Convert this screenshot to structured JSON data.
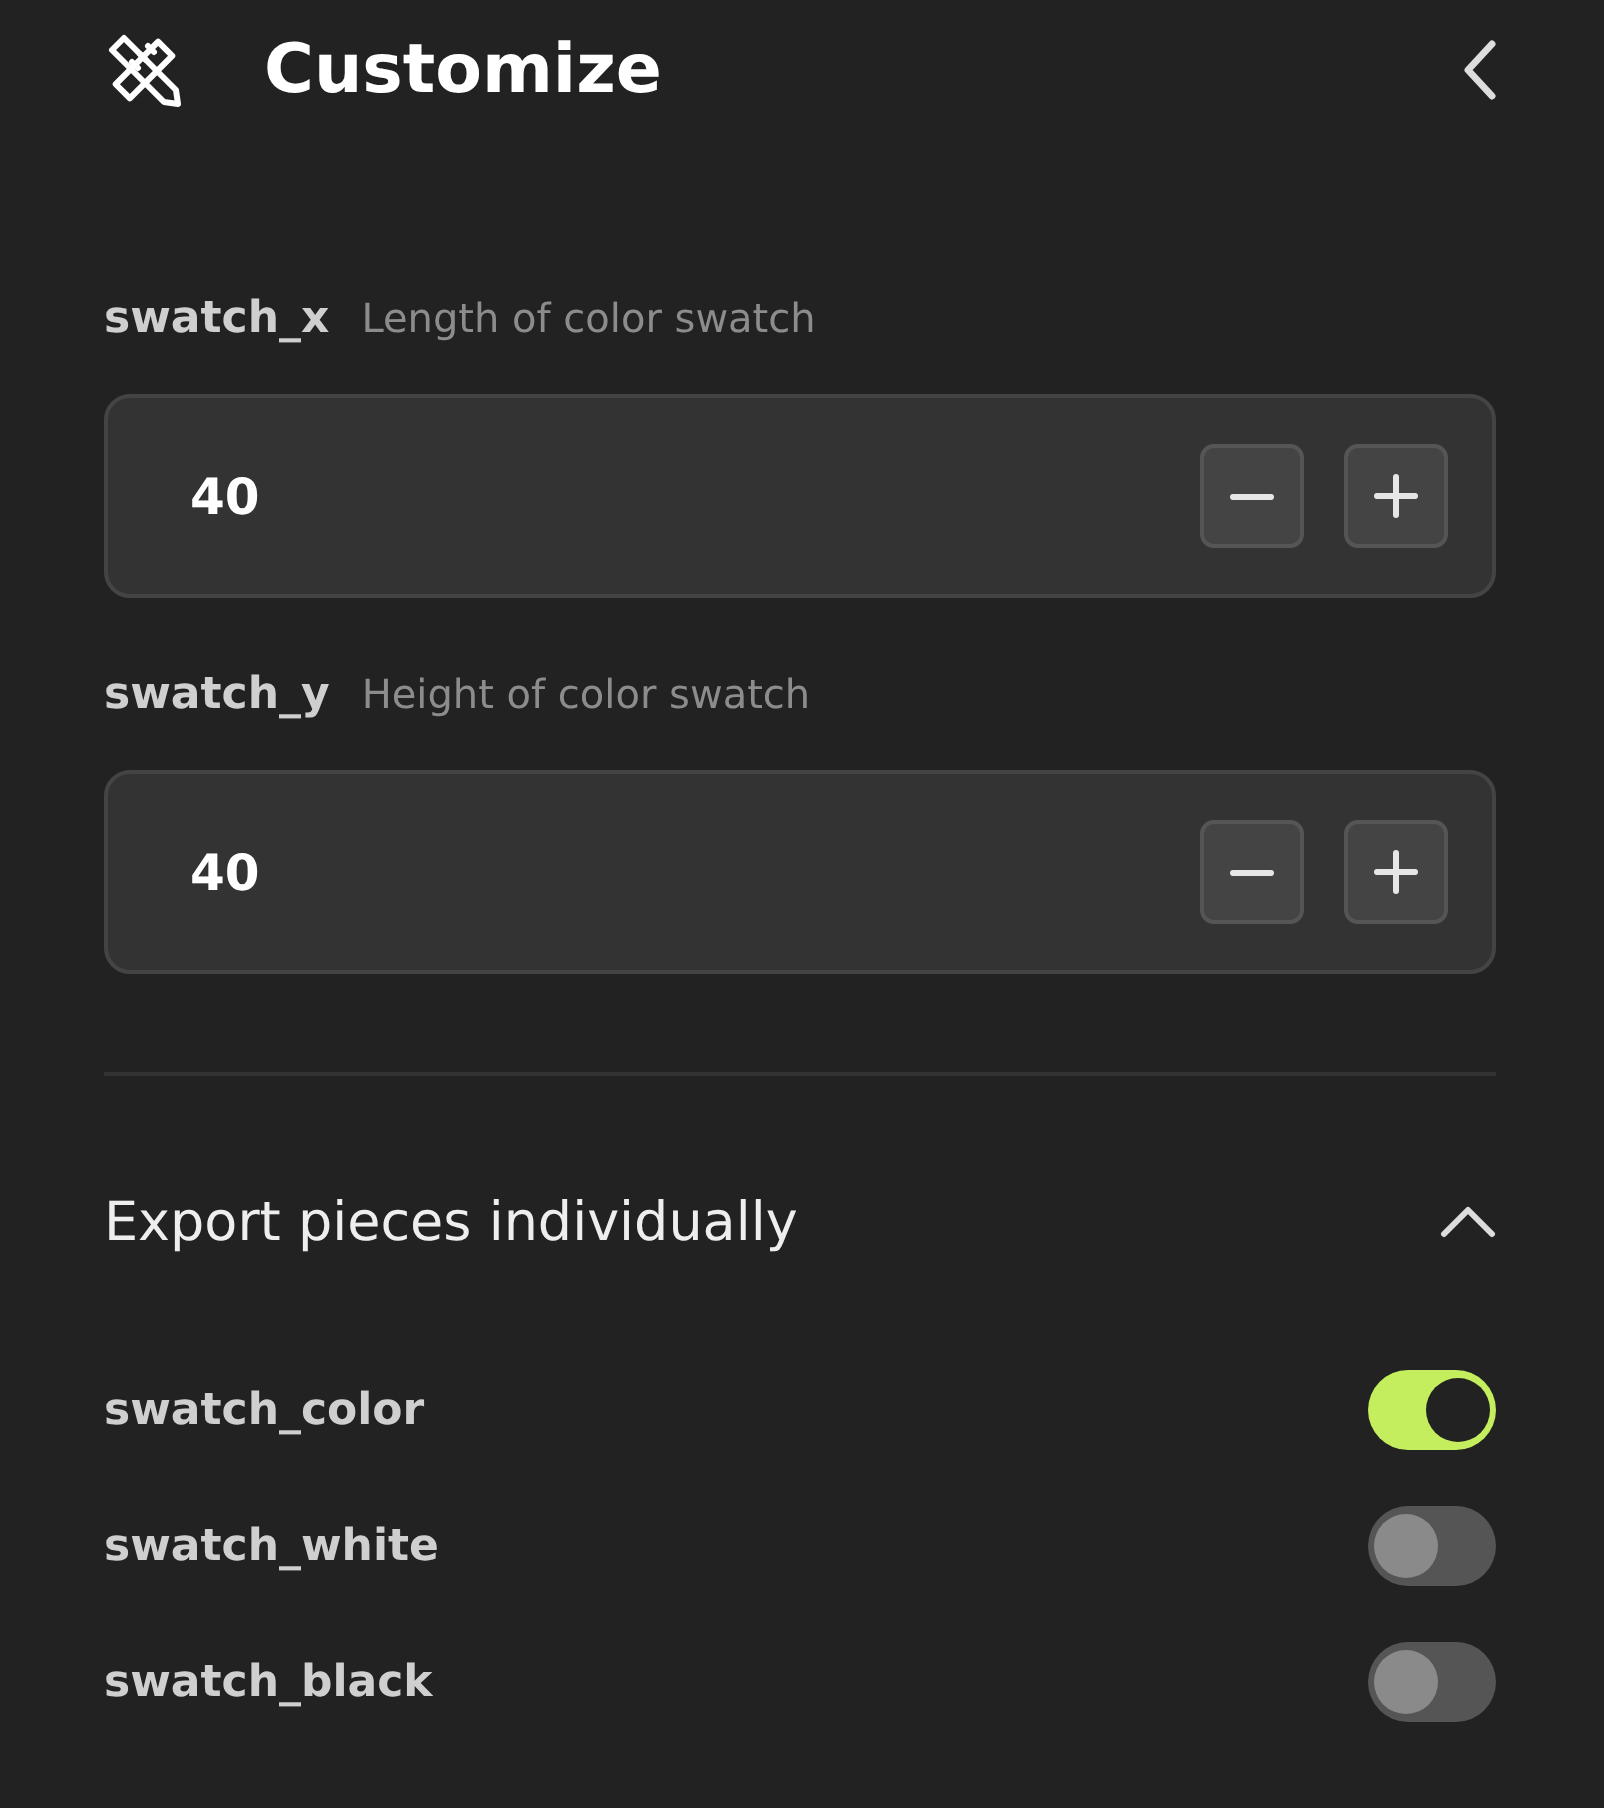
{
  "header": {
    "title": "Customize"
  },
  "parameters": [
    {
      "name": "swatch_x",
      "description": "Length of color swatch",
      "value": "40"
    },
    {
      "name": "swatch_y",
      "description": "Height of color swatch",
      "value": "40"
    }
  ],
  "export_section": {
    "title": "Export pieces individually",
    "expanded": true,
    "pieces": [
      {
        "name": "swatch_color",
        "on": true
      },
      {
        "name": "swatch_white",
        "on": false
      },
      {
        "name": "swatch_black",
        "on": false
      }
    ]
  }
}
